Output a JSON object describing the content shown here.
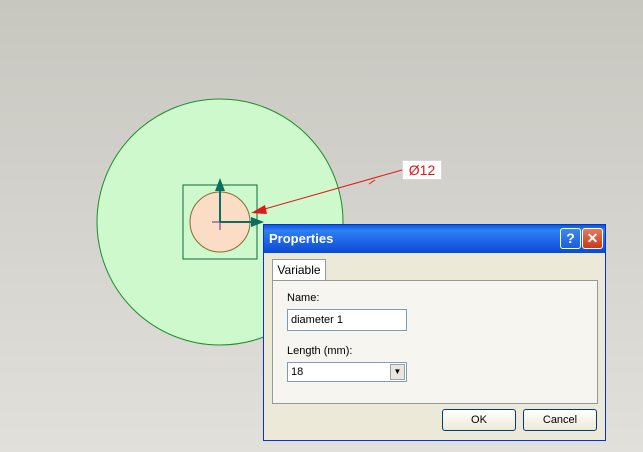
{
  "canvas": {
    "dimension_label": "Ø12",
    "colors": {
      "outer_circle_fill": "#cdf9cc",
      "outer_circle_stroke": "#1e8e2a",
      "inner_circle_fill": "#fbdcc4",
      "dimension_line": "#e01818",
      "axis_arrow": "#0b6e5e"
    }
  },
  "dialog": {
    "title": "Properties",
    "help_label": "?",
    "close_label": "✕",
    "tab_label": "Variable",
    "name_label": "Name:",
    "name_value": "diameter 1",
    "length_label": "Length (mm):",
    "length_value": "18",
    "ok_label": "OK",
    "cancel_label": "Cancel",
    "colors": {
      "title_bar": "#0a5ad8",
      "background": "#ece9d8"
    }
  }
}
